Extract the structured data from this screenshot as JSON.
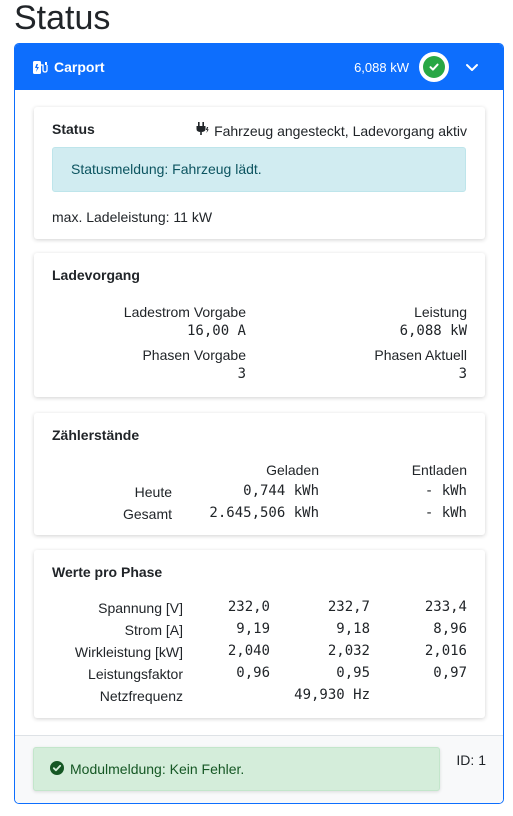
{
  "page": {
    "title": "Status"
  },
  "header": {
    "title": "Carport",
    "power": "6,088 kW",
    "icons": [
      "charger-plug-icon",
      "check-icon",
      "chevron-down-icon"
    ],
    "colors": {
      "primary": "#0d6efd",
      "ok": "#28a745"
    }
  },
  "status_card": {
    "title": "Status",
    "state": "Fahrzeug angesteckt, Ladevorgang aktiv",
    "alert": "Statusmeldung: Fahrzeug lädt.",
    "max_power": "max. Ladeleistung: 11 kW"
  },
  "charge_card": {
    "title": "Ladevorgang",
    "items": [
      {
        "label": "Ladestrom Vorgabe",
        "value": "16,00 A"
      },
      {
        "label": "Leistung",
        "value": "6,088 kW"
      },
      {
        "label": "Phasen Vorgabe",
        "value": "3"
      },
      {
        "label": "Phasen Aktuell",
        "value": "3"
      }
    ]
  },
  "meter_card": {
    "title": "Zählerstände",
    "columns": [
      "Geladen",
      "Entladen"
    ],
    "rows": [
      {
        "label": "Heute",
        "charged": "0,744 kWh",
        "discharged": "- kWh"
      },
      {
        "label": "Gesamt",
        "charged": "2.645,506 kWh",
        "discharged": "- kWh"
      }
    ]
  },
  "phase_card": {
    "title": "Werte pro Phase",
    "rows": [
      {
        "label": "Spannung [V]",
        "values": [
          "232,0",
          "232,7",
          "233,4"
        ]
      },
      {
        "label": "Strom [A]",
        "values": [
          "9,19",
          "9,18",
          "8,96"
        ]
      },
      {
        "label": "Wirkleistung [kW]",
        "values": [
          "2,040",
          "2,032",
          "2,016"
        ]
      },
      {
        "label": "Leistungsfaktor",
        "values": [
          "0,96",
          "0,95",
          "0,97"
        ]
      }
    ],
    "frequency": {
      "label": "Netzfrequenz",
      "value": "49,930 Hz"
    }
  },
  "footer": {
    "message": "Modulmeldung: Kein Fehler.",
    "id": "ID: 1"
  }
}
